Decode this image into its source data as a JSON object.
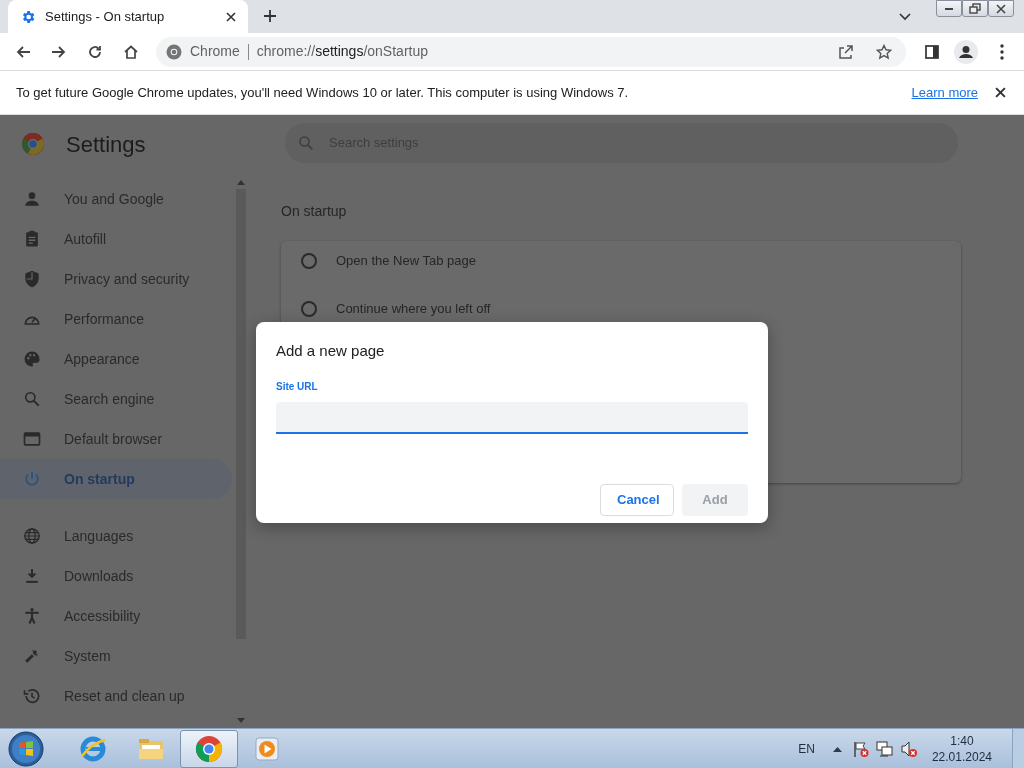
{
  "tabs": [
    {
      "title": "Settings - On startup",
      "selected": true
    }
  ],
  "address_bar": {
    "origin": "Chrome",
    "scheme": "chrome://",
    "host": "settings",
    "path": "/onStartup"
  },
  "info_bar": {
    "message": "To get future Google Chrome updates, you'll need Windows 10 or later. This computer is using Windows 7.",
    "link": "Learn more"
  },
  "settings": {
    "title": "Settings",
    "search_placeholder": "Search settings",
    "nav": [
      {
        "label": "You and Google",
        "selected": false
      },
      {
        "label": "Autofill",
        "selected": false
      },
      {
        "label": "Privacy and security",
        "selected": false
      },
      {
        "label": "Performance",
        "selected": false
      },
      {
        "label": "Appearance",
        "selected": false
      },
      {
        "label": "Search engine",
        "selected": false
      },
      {
        "label": "Default browser",
        "selected": false
      },
      {
        "label": "On startup",
        "selected": true
      },
      {
        "label": "Languages",
        "selected": false
      },
      {
        "label": "Downloads",
        "selected": false
      },
      {
        "label": "Accessibility",
        "selected": false
      },
      {
        "label": "System",
        "selected": false
      },
      {
        "label": "Reset and clean up",
        "selected": false
      }
    ],
    "section_title": "On startup",
    "options": [
      {
        "label": "Open the New Tab page",
        "selected": false
      },
      {
        "label": "Continue where you left off",
        "selected": false
      }
    ]
  },
  "dialog": {
    "title": "Add a new page",
    "field_label": "Site URL",
    "buttons": [
      {
        "label": "Cancel",
        "disabled": false
      },
      {
        "label": "Add",
        "disabled": true
      }
    ]
  },
  "taskbar": {
    "apps": [
      {
        "selected": false
      },
      {
        "selected": false
      },
      {
        "selected": true
      },
      {
        "selected": false
      }
    ],
    "language": "EN",
    "time": "1:40",
    "date": "22.01.2024"
  }
}
